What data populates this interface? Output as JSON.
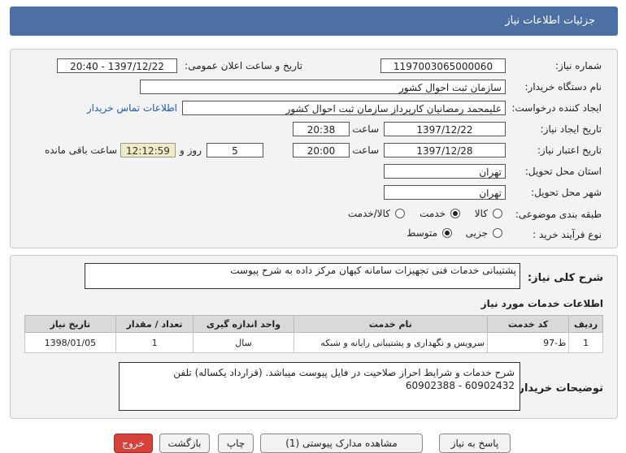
{
  "header": {
    "title": "جزئیات اطلاعات نیاز"
  },
  "form": {
    "need_number": {
      "label": "شماره نیاز:",
      "value": "1197003065000060"
    },
    "announce": {
      "label": "تاریخ و ساعت اعلان عمومی:",
      "value": "1397/12/22 - 20:40"
    },
    "buyer_org": {
      "label": "نام دستگاه خریدار:",
      "value": "سازمان ثبت احوال کشور"
    },
    "requester": {
      "label": "ایجاد کننده درخواست:",
      "value": "علیمحمد رمضانیان کارپرداز سازمان ثبت احوال کشور",
      "contact_link": "اطلاعات تماس خریدار"
    },
    "created": {
      "label": "تاریخ ایجاد نیاز:",
      "date": "1397/12/22",
      "time_label": "ساعت",
      "time": "20:38"
    },
    "validity": {
      "label": "تاریخ اعتبار نیاز:",
      "date": "1397/12/28",
      "time_label": "ساعت",
      "time": "20:00",
      "days": "5",
      "days_label": "روز و",
      "remaining": "12:12:59",
      "remaining_label": "ساعت باقی مانده"
    },
    "province": {
      "label": "استان محل تحویل:",
      "value": "تهران"
    },
    "city": {
      "label": "شهر محل تحویل:",
      "value": "تهران"
    },
    "category": {
      "label": "طبقه بندی موضوعی:",
      "options": [
        "کالا",
        "خدمت",
        "کالا/خدمت"
      ],
      "selected": "خدمت"
    },
    "process": {
      "label": "نوع فرآیند خرید :",
      "options": [
        "جزیی",
        "متوسط"
      ],
      "selected": "متوسط"
    }
  },
  "summary": {
    "label": "شرح کلی نیاز:",
    "value": "پشتیبانی خدمات فنی تجهیزات سامانه کیهان مرکز داده به شرح پیوست"
  },
  "services": {
    "heading": "اطلاعات خدمات مورد نیاز",
    "columns": [
      "ردیف",
      "کد خدمت",
      "نام خدمت",
      "واحد اندازه گیری",
      "تعداد / مقدار",
      "تاریخ نیاز"
    ],
    "rows": [
      [
        "1",
        "ط-97",
        "سرویس و نگهداری و پشتیبانی رایانه و شبکه",
        "سال",
        "1",
        "1398/01/05"
      ]
    ]
  },
  "buyer_notes": {
    "label": "توضیحات خریدار:",
    "value": "شرح خدمات و شرایط احراز صلاحیت در فایل پیوست میباشد. (قرارداد یکساله) تلفن 60902432 - 60902388"
  },
  "buttons": {
    "reply": "پاسخ به نیاز",
    "view_docs": "مشاهده مدارک پیوستی (1)",
    "print": "چاپ",
    "back": "بازگشت",
    "exit": "خروج"
  },
  "colors": {
    "header_bg": "#4c70a3",
    "exit_button": "#d4423a",
    "remaining_bg": "#f0ebc4",
    "link": "#1a5bb8"
  }
}
